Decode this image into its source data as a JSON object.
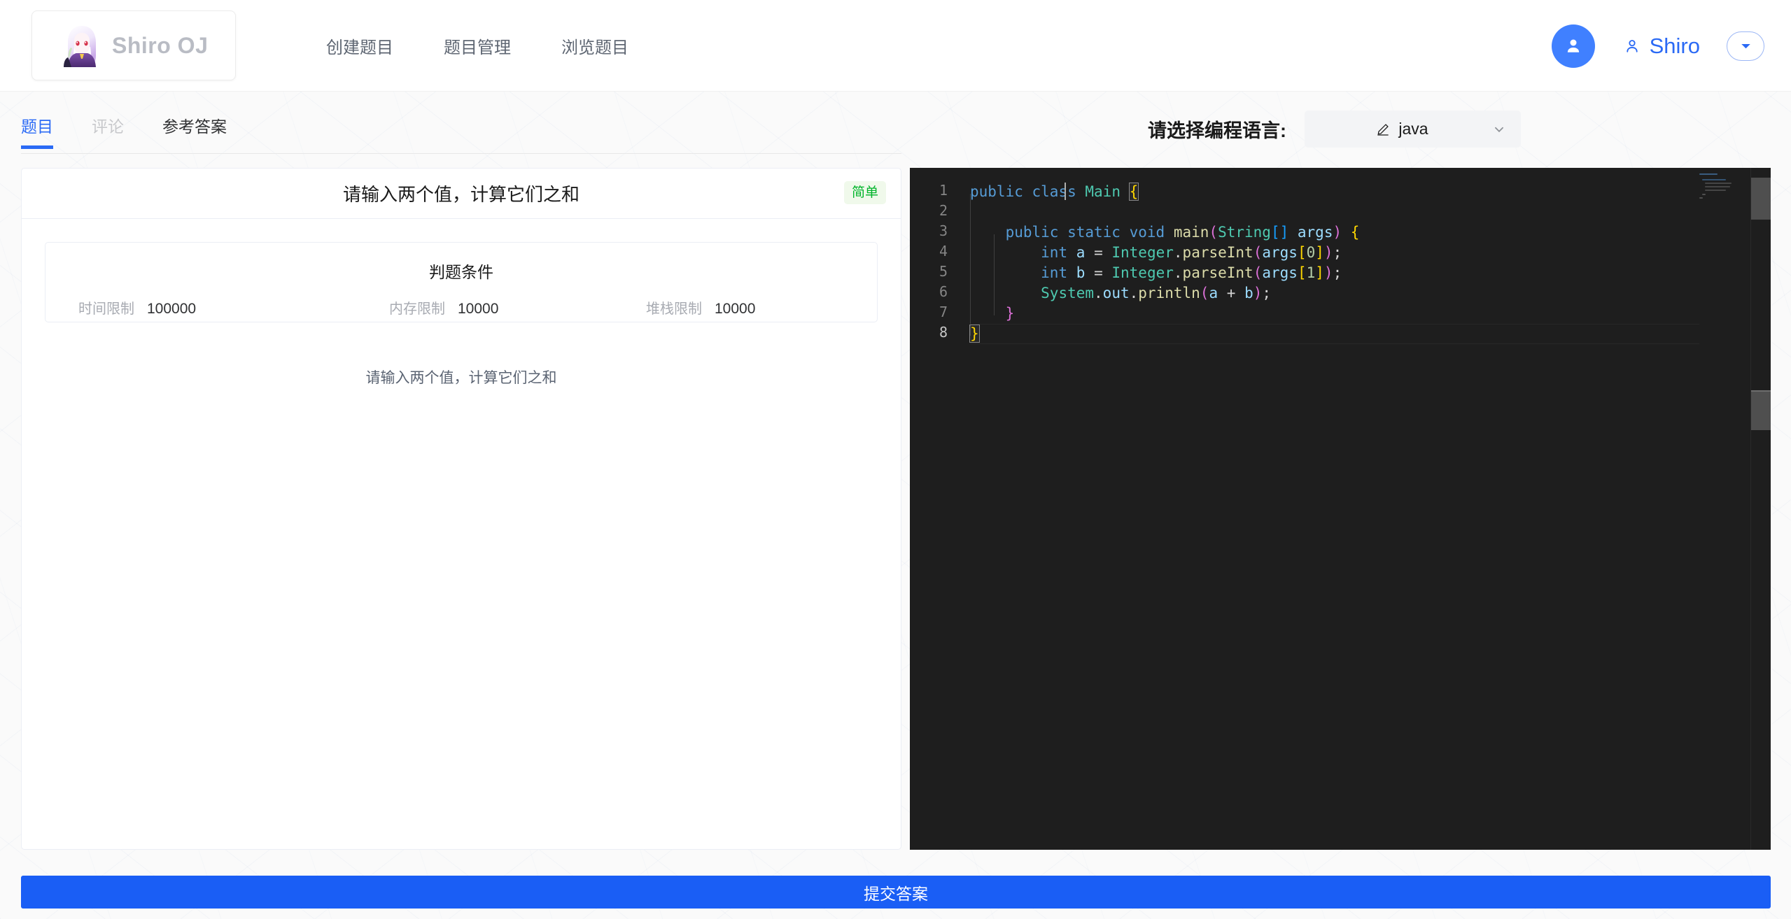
{
  "header": {
    "logo_title": "Shiro OJ",
    "logo_icon": "anime-avatar-icon",
    "nav": [
      {
        "label": "创建题目"
      },
      {
        "label": "题目管理"
      },
      {
        "label": "浏览题目"
      }
    ],
    "user": {
      "avatar_icon": "user-avatar-icon",
      "name_icon": "user-icon",
      "name": "Shiro",
      "dropdown_icon": "caret-down-icon"
    }
  },
  "tabs": [
    {
      "label": "题目",
      "state": "active"
    },
    {
      "label": "评论",
      "state": "disabled"
    },
    {
      "label": "参考答案",
      "state": "normal"
    }
  ],
  "problem": {
    "title": "请输入两个值，计算它们之和",
    "difficulty": "简单",
    "judge_title": "判题条件",
    "limits": [
      {
        "label": "时间限制",
        "value": "100000"
      },
      {
        "label": "内存限制",
        "value": "10000"
      },
      {
        "label": "堆栈限制",
        "value": "10000"
      }
    ],
    "description": "请输入两个值，计算它们之和"
  },
  "language": {
    "label": "请选择编程语言:",
    "edit_icon": "pencil-icon",
    "selected": "java",
    "chevron_icon": "chevron-down-icon"
  },
  "editor": {
    "line_numbers": [
      "1",
      "2",
      "3",
      "4",
      "5",
      "6",
      "7",
      "8"
    ],
    "current_line": "8",
    "code_lines": [
      "public class Main {",
      "",
      "    public static void main(String[] args) {",
      "        int a = Integer.parseInt(args[0]);",
      "        int b = Integer.parseInt(args[1]);",
      "        System.out.println(a + b);",
      "    }",
      "}"
    ]
  },
  "submit": {
    "label": "提交答案"
  },
  "colors": {
    "accent": "#2b6af5",
    "submit": "#1a5ef5",
    "badge_bg": "#f0f9eb",
    "badge_text": "#00b42a",
    "editor_bg": "#1e1e1e",
    "keyword": "#569cd6",
    "type": "#4ec9b0",
    "function": "#dcdcaa",
    "variable": "#9cdcfe",
    "number": "#b5cea8"
  }
}
